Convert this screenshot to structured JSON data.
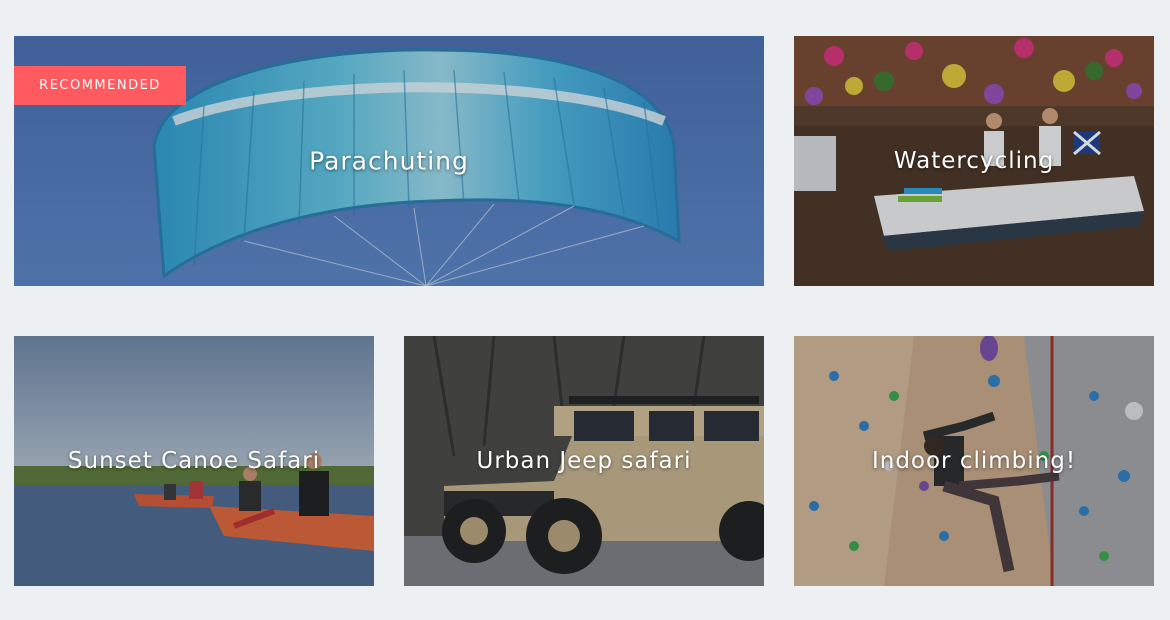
{
  "colors": {
    "page_background": "#edf0f2",
    "badge": "#ff5a5f",
    "title_text": "#ffffff"
  },
  "cards": [
    {
      "title": "Parachuting",
      "badge": "RECOMMENDED",
      "image": "parachute-photo"
    },
    {
      "title": "Watercycling",
      "image": "pedal-boat-photo"
    },
    {
      "title": "Sunset Canoe Safari",
      "image": "canoe-photo"
    },
    {
      "title": "Urban Jeep safari",
      "image": "jeep-photo"
    },
    {
      "title": "Indoor climbing!",
      "image": "climbing-wall-photo"
    }
  ]
}
